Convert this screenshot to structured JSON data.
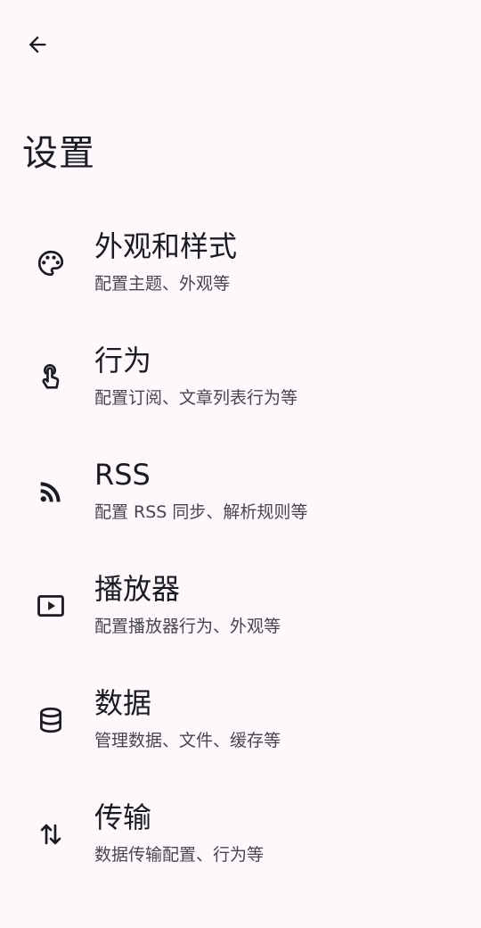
{
  "page": {
    "title": "设置"
  },
  "settings": {
    "items": [
      {
        "icon": "palette-icon",
        "title": "外观和样式",
        "subtitle": "配置主题、外观等"
      },
      {
        "icon": "touch-icon",
        "title": "行为",
        "subtitle": "配置订阅、文章列表行为等"
      },
      {
        "icon": "rss-feed-icon",
        "title": "RSS",
        "subtitle": "配置 RSS 同步、解析规则等"
      },
      {
        "icon": "play-box-icon",
        "title": "播放器",
        "subtitle": "配置播放器行为、外观等"
      },
      {
        "icon": "database-icon",
        "title": "数据",
        "subtitle": "管理数据、文件、缓存等"
      },
      {
        "icon": "swap-vertical-icon",
        "title": "传输",
        "subtitle": "数据传输配置、行为等"
      }
    ]
  },
  "colors": {
    "background": "#fcf8fc",
    "text_primary": "#1c1b1f",
    "text_secondary": "#49454f"
  }
}
